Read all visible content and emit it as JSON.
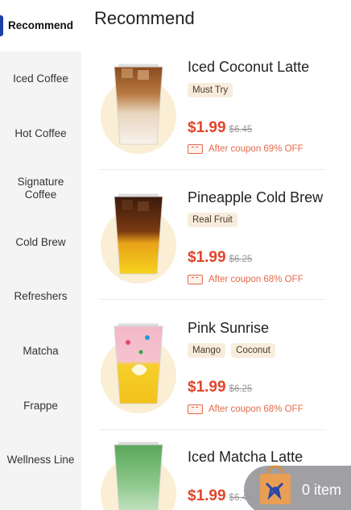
{
  "sidebar": {
    "items": [
      {
        "label": "Recommend",
        "active": true
      },
      {
        "label": "Iced Coffee"
      },
      {
        "label": "Hot Coffee"
      },
      {
        "label": "Signature Coffee"
      },
      {
        "label": "Cold Brew"
      },
      {
        "label": "Refreshers"
      },
      {
        "label": "Matcha"
      },
      {
        "label": "Frappe"
      },
      {
        "label": "Wellness Line"
      }
    ],
    "accent": "#1c3fa8"
  },
  "main": {
    "title": "Recommend",
    "products": [
      {
        "name": "Iced Coconut Latte",
        "tags": [
          "Must Try"
        ],
        "price": "$1.99",
        "original_price": "$6.45",
        "coupon": "After coupon 69% OFF"
      },
      {
        "name": "Pineapple Cold Brew",
        "tags": [
          "Real Fruit"
        ],
        "price": "$1.99",
        "original_price": "$6.25",
        "coupon": "After coupon 68% OFF"
      },
      {
        "name": "Pink Sunrise",
        "tags": [
          "Mango",
          "Coconut"
        ],
        "price": "$1.99",
        "original_price": "$6.25",
        "coupon": "After coupon 68% OFF"
      },
      {
        "name": "Iced Matcha Latte",
        "tags": [],
        "price": "$1.99",
        "original_price": "$6.45",
        "coupon": ""
      }
    ],
    "price_color": "#e0452a"
  },
  "cart": {
    "label": "0 item"
  }
}
